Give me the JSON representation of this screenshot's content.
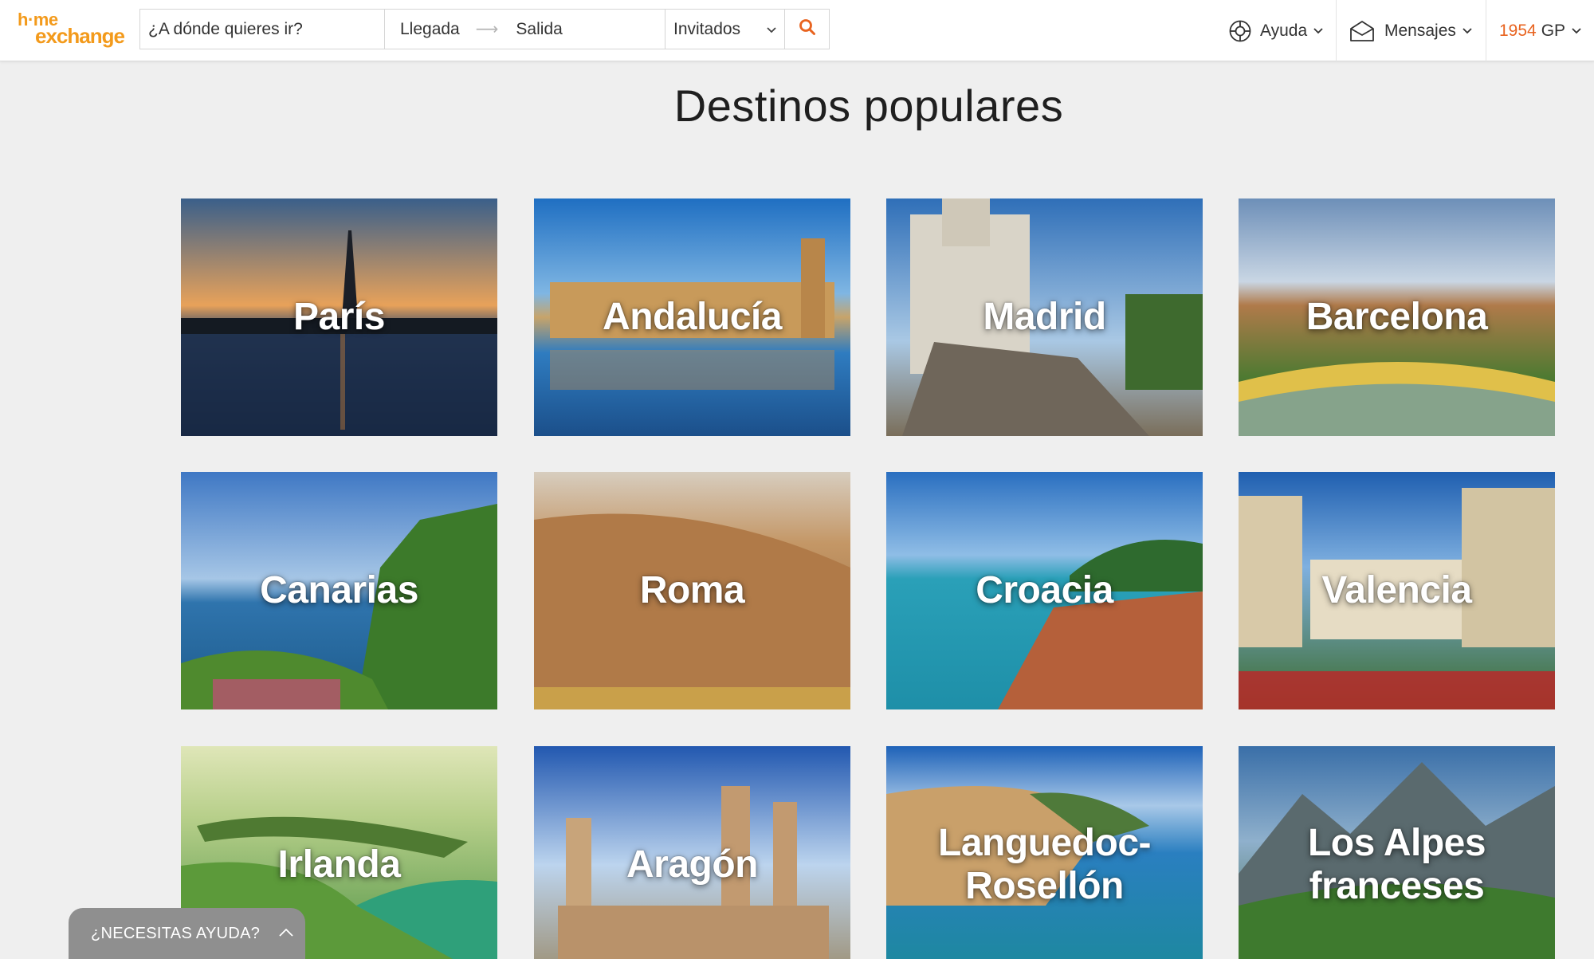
{
  "brand": {
    "logo_top": "h·me",
    "logo_bottom": "exchange"
  },
  "search": {
    "destination_placeholder": "¿A dónde quieres ir?",
    "arrival_label": "Llegada",
    "departure_label": "Salida",
    "guests_label": "Invitados",
    "icons": {
      "guests_dropdown": "chevron-down-icon",
      "submit": "search-icon",
      "dates_arrow": "arrow-right-icon"
    }
  },
  "nav": {
    "help_label": "Ayuda",
    "messages_label": "Mensajes",
    "points_value": "1954",
    "points_unit": "GP"
  },
  "page": {
    "title": "Destinos populares"
  },
  "destinations": [
    {
      "name": "París"
    },
    {
      "name": "Andalucía"
    },
    {
      "name": "Madrid"
    },
    {
      "name": "Barcelona"
    },
    {
      "name": "Canarias"
    },
    {
      "name": "Roma"
    },
    {
      "name": "Croacia"
    },
    {
      "name": "Valencia"
    },
    {
      "name": "Irlanda"
    },
    {
      "name": "Aragón"
    },
    {
      "name": "Languedoc-Rosellón"
    },
    {
      "name": "Los Alpes franceses"
    }
  ],
  "help_widget": {
    "label": "¿NECESITAS AYUDA?"
  },
  "colors": {
    "brand_orange": "#f39a1b",
    "accent_orange": "#e8631f",
    "page_bg": "#efefef"
  }
}
